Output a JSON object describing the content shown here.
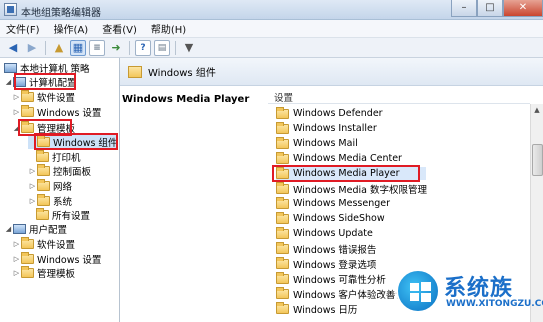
{
  "window": {
    "title": "本地组策略编辑器",
    "controls": {
      "minimize": "–",
      "maximize": "□",
      "close": "✕"
    }
  },
  "menubar": {
    "items": [
      "文件(F)",
      "操作(A)",
      "查看(V)",
      "帮助(H)"
    ]
  },
  "toolbar": {
    "icons": [
      "back-arrow-icon",
      "forward-arrow-icon",
      "up-folder-icon",
      "show-hide-tree-icon",
      "export-list-icon",
      "help-icon",
      "properties-icon",
      "filter-icon"
    ]
  },
  "tree": {
    "root": "本地计算机 策略",
    "computer_config": "计算机配置",
    "software_settings": "软件设置",
    "windows_settings": "Windows 设置",
    "admin_templates": "管理模板",
    "windows_components": "Windows 组件",
    "printers": "打印机",
    "control_panel": "控制面板",
    "network": "网络",
    "system": "系统",
    "all_settings": "所有设置",
    "user_config": "用户配置",
    "user_software_settings": "软件设置",
    "user_windows_settings": "Windows 设置",
    "user_admin_templates": "管理模板"
  },
  "right_pane": {
    "header": "Windows 组件",
    "detail_title": "Windows Media Player",
    "column_header": "设置",
    "items": [
      "Windows Defender",
      "Windows Installer",
      "Windows Mail",
      "Windows Media Center",
      "Windows Media Player",
      "Windows Media 数字权限管理",
      "Windows Messenger",
      "Windows SideShow",
      "Windows Update",
      "Windows 错误报告",
      "Windows 登录选项",
      "Windows 可靠性分析",
      "Windows 客户体验改善计划",
      "Windows 日历"
    ],
    "selected_index": 4
  },
  "watermark": {
    "name": "系统族",
    "url": "WWW.XITONGZU.COM"
  },
  "colors": {
    "highlight_red": "#e01b24",
    "selection_blue": "#d9e8fa",
    "watermark_blue": "#1b6fc9"
  }
}
